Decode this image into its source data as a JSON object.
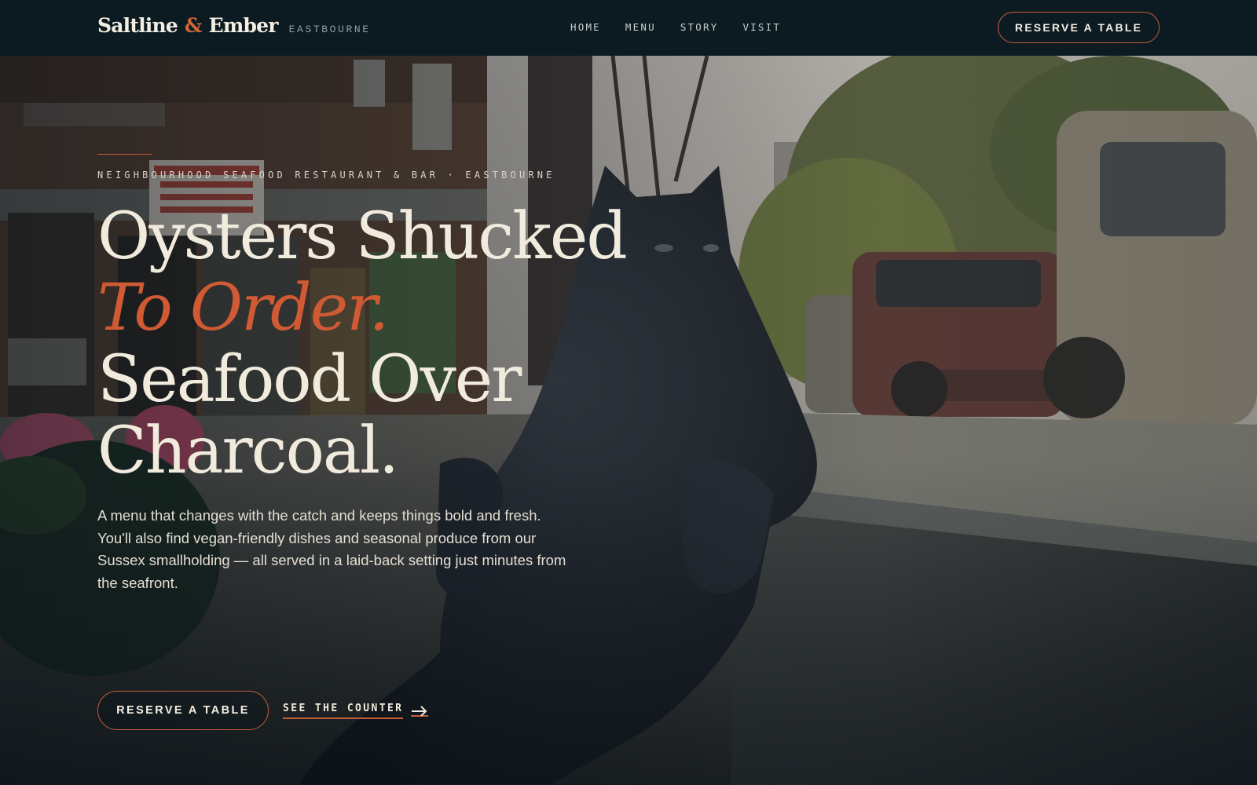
{
  "brand": {
    "name_part1": "Saltline",
    "amp": "&",
    "name_part2": "Ember",
    "location": "EASTBOURNE"
  },
  "nav": {
    "links": [
      "HOME",
      "MENU",
      "STORY",
      "VISIT"
    ],
    "cta_label": "RESERVE A TABLE"
  },
  "hero": {
    "eyebrow": "NEIGHBOURHOOD SEAFOOD RESTAURANT & BAR · EASTBOURNE",
    "headline_line1": "Oysters Shucked",
    "headline_accent": "To Order.",
    "headline_line3": "Seafood Over",
    "headline_line4": "Charcoal.",
    "lede": "A menu that changes with the catch and keeps things bold and fresh. You'll also find vegan-friendly dishes and seasonal produce from our Sussex smallholding — all served in a laid-back setting just minutes from the seafront.",
    "primary_cta": "RESERVE A TABLE",
    "secondary_cta": "SEE THE COUNTER",
    "secondary_icon": "arrow-right-icon"
  },
  "colors": {
    "nav_bg": "#0c1b22",
    "accent": "#c55b37",
    "cream": "#f1ebdd"
  }
}
